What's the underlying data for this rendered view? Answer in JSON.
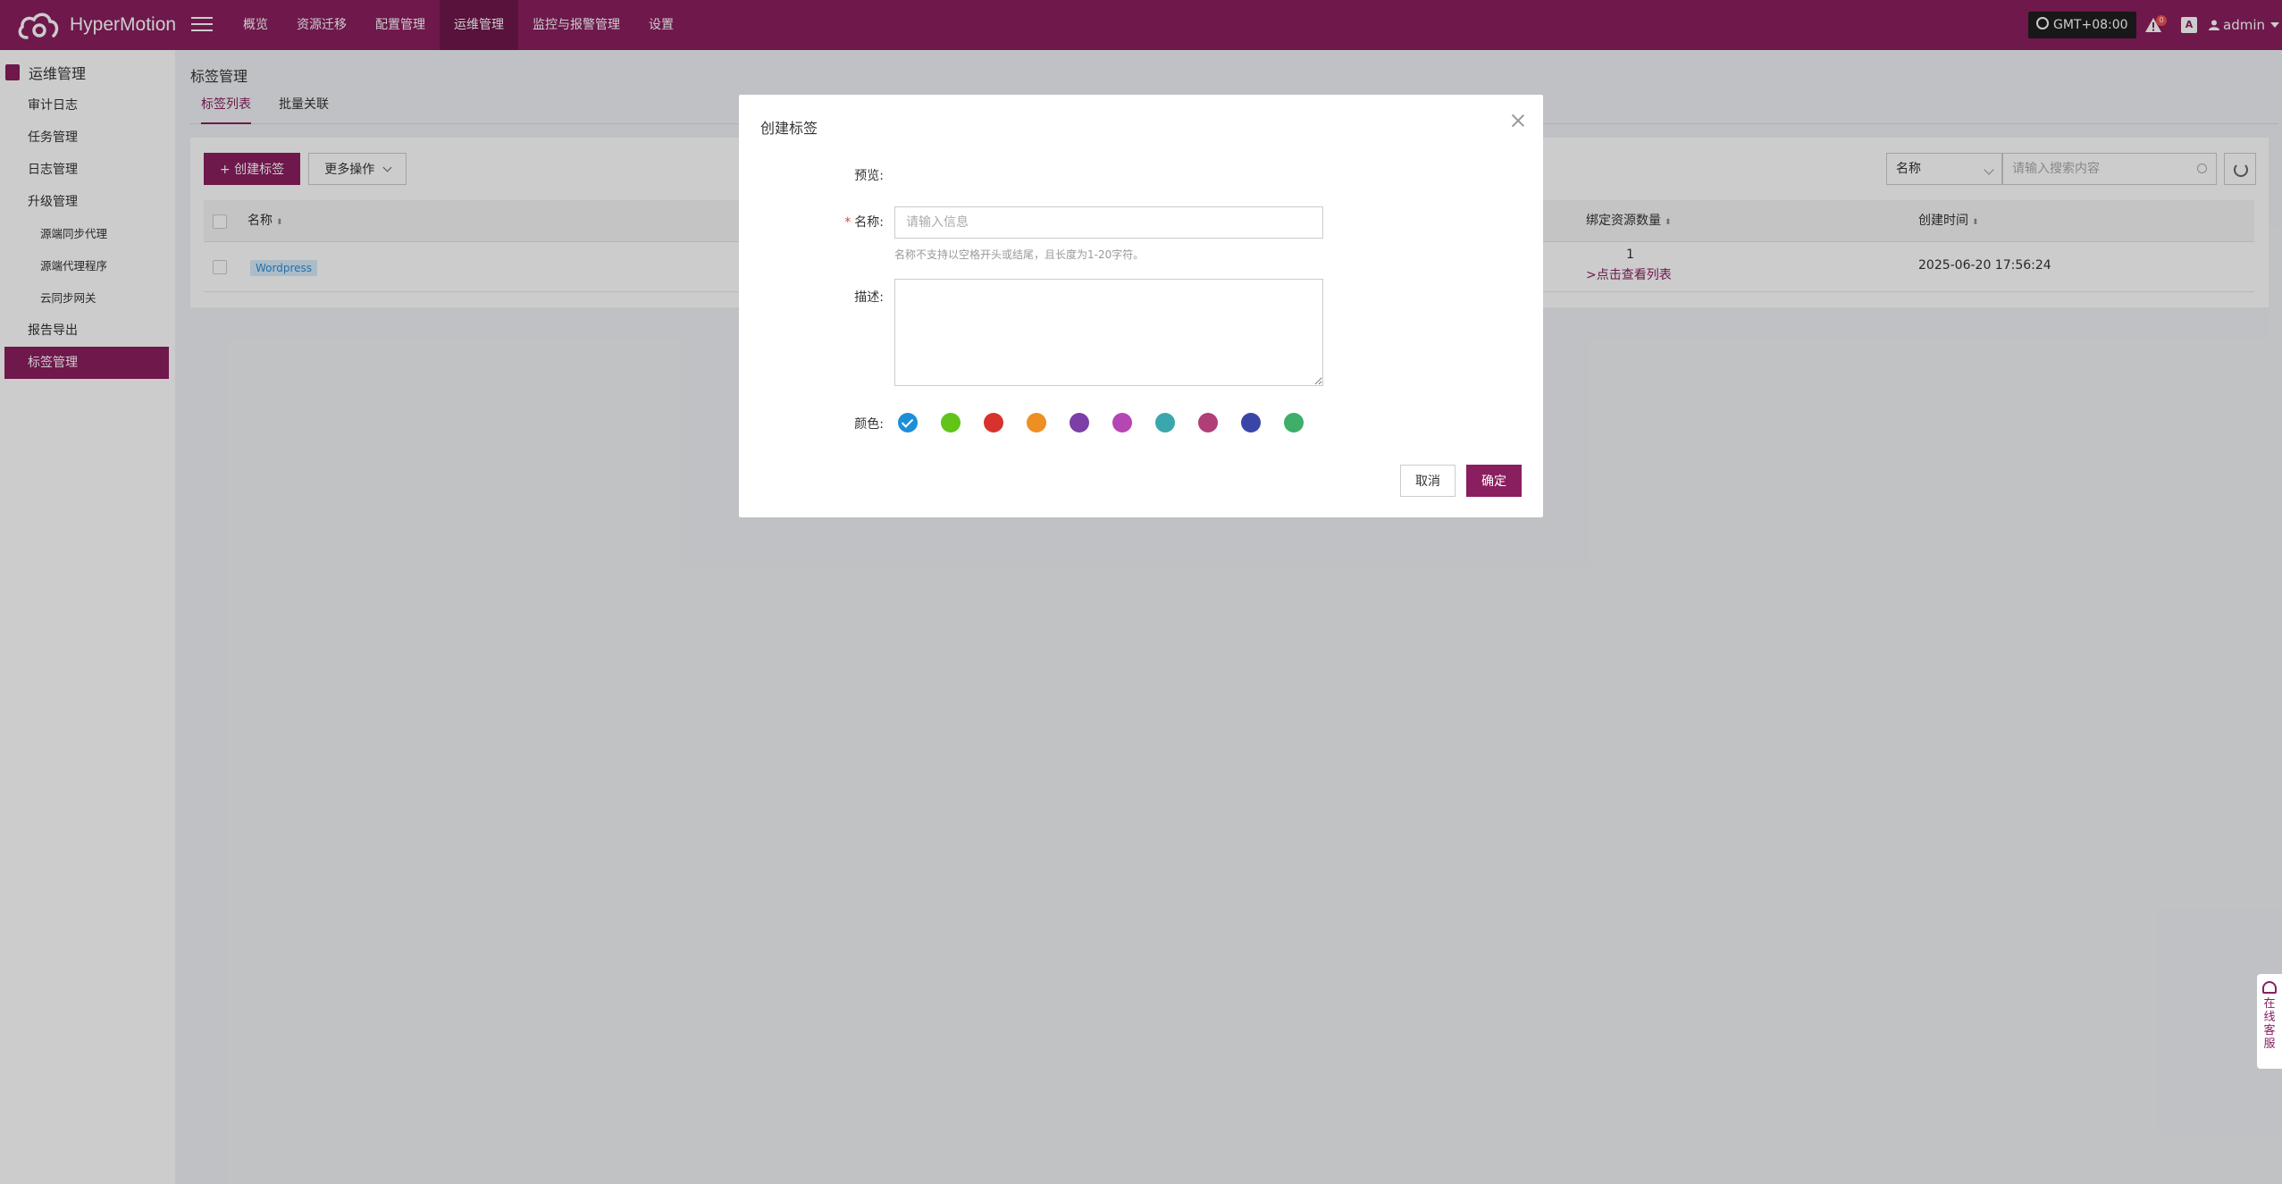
{
  "app": {
    "name": "HyperMotion"
  },
  "topnav": {
    "items": [
      {
        "label": "概览"
      },
      {
        "label": "资源迁移"
      },
      {
        "label": "配置管理"
      },
      {
        "label": "运维管理"
      },
      {
        "label": "监控与报警管理"
      },
      {
        "label": "设置"
      }
    ],
    "active_index": 3,
    "timezone": "GMT+08:00",
    "alert_count": "0",
    "lang_icon": "A",
    "user": "admin"
  },
  "sidebar": {
    "section": "运维管理",
    "items": [
      {
        "label": "审计日志"
      },
      {
        "label": "任务管理"
      },
      {
        "label": "日志管理"
      },
      {
        "label": "升级管理"
      },
      {
        "label": "源端同步代理"
      },
      {
        "label": "源端代理程序"
      },
      {
        "label": "云同步网关"
      },
      {
        "label": "报告导出"
      },
      {
        "label": "标签管理"
      }
    ],
    "active": "标签管理"
  },
  "page": {
    "title": "标签管理",
    "tabs": [
      {
        "label": "标签列表"
      },
      {
        "label": "批量关联"
      }
    ],
    "active_tab": "标签列表",
    "toolbar": {
      "create_label": "+ 创建标签",
      "more_label": "更多操作",
      "search_field": "名称",
      "search_placeholder": "请输入搜索内容"
    },
    "table": {
      "columns": [
        "名称",
        "绑定资源数量",
        "创建时间"
      ],
      "rows": [
        {
          "name": "Wordpress",
          "bound_count": "1",
          "bound_link": ">点击查看列表",
          "created": "2025-06-20 17:56:24"
        }
      ]
    }
  },
  "modal": {
    "title": "创建标签",
    "preview_label": "预览:",
    "name_label": "名称:",
    "name_required_mark": "*",
    "name_placeholder": "请输入信息",
    "name_hint": "名称不支持以空格开头或结尾，且长度为1-20字符。",
    "desc_label": "描述:",
    "color_label": "颜色:",
    "colors": [
      "#1a8fd8",
      "#62c318",
      "#d8322e",
      "#ee8f22",
      "#7b3fa7",
      "#b447b3",
      "#3aa7ac",
      "#b03e77",
      "#3b45a8",
      "#3eae6a"
    ],
    "selected_color_index": 0,
    "cancel_label": "取消",
    "ok_label": "确定"
  },
  "support": {
    "text": "在线客服"
  },
  "icons": {
    "logo": "cloud-logo-icon",
    "menu": "hamburger-menu-icon",
    "clock": "clock-icon",
    "alert": "alert-triangle-icon",
    "lang": "language-icon",
    "user": "user-icon",
    "section": "ops-section-icon",
    "search": "search-icon",
    "refresh": "refresh-icon",
    "close": "close-icon",
    "support": "headset-icon"
  }
}
